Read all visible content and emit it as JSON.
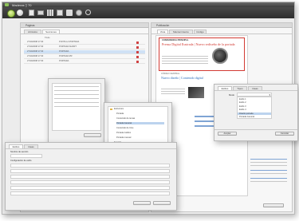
{
  "app": {
    "title": "Maderas ▯ 70"
  },
  "toolbar": {
    "icons": [
      "back-icon",
      "forward-icon",
      "new-document-icon",
      "folder-icon",
      "grid-icon",
      "save-icon",
      "print-icon",
      "settings-icon",
      "search-icon"
    ]
  },
  "left_panel": {
    "title": "Páginas",
    "tabs": [
      "Artículos",
      "Secciones"
    ],
    "column": "Título",
    "rows": [
      {
        "date": "27/10/2008 17:30",
        "label": "PUNTA LA PORTADA"
      },
      {
        "date": "27/10/2008 17:30",
        "label": "PORTADA SHORT"
      },
      {
        "date": "27/10/2008 17:30",
        "label": "PORTADA"
      },
      {
        "date": "27/10/2008 17:30",
        "label": "PORTADA PR"
      },
      {
        "date": "27/10/2008 17:30",
        "label": "PORTADA"
      }
    ]
  },
  "right_panel": {
    "title": "Publicación",
    "tabs": [
      "Vista",
      "Mantenimiento",
      "Código"
    ],
    "section_label": "CONFERENCIA PRINCIPAL",
    "headline": "Prensa Digital Ilustrada | Nuevo rediseño de la portada",
    "section_label_2": "CÓDIGO CENTRAL",
    "headline_2": "Nuevo diseño | Contenido digital"
  },
  "colors": {
    "accent_red": "#d23a32",
    "link_blue": "#2f6fbd",
    "selection": "#cfe1f5"
  },
  "style_dialog": {
    "tabs": [
      "Estilos",
      "Tipos",
      "Ideas"
    ],
    "field_label": "Modo",
    "options": [
      "Estilo 1",
      "Estilo 2",
      "Estilo 3",
      "Estilo 4",
      "Diseño portada",
      "Portada General"
    ],
    "buttons": [
      "Aceptar",
      "Cancelar"
    ]
  },
  "template_dialog": {
    "items": [
      "Estructura",
      "Portada",
      "Contenido de temas",
      "Portada General",
      "Contenido de Cine",
      "Portada Gráfico",
      "Portada manual",
      "Sección",
      "Sección A"
    ]
  },
  "props_dialog": {
    "tabs": [
      "Estilos",
      "Ideas"
    ],
    "labels": [
      "Nombre de sección",
      "Configuración de estilo"
    ]
  }
}
